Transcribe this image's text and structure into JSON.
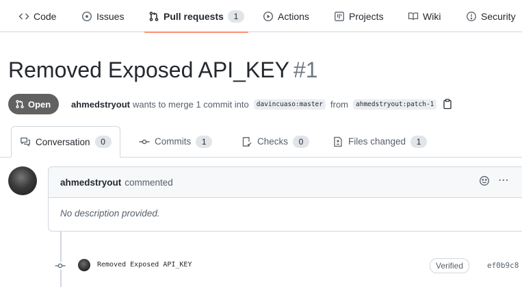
{
  "nav": {
    "items": [
      {
        "label": "Code",
        "icon": "code-icon"
      },
      {
        "label": "Issues",
        "icon": "issue-opened-icon"
      },
      {
        "label": "Pull requests",
        "icon": "git-pull-request-icon",
        "count": "1",
        "selected": true
      },
      {
        "label": "Actions",
        "icon": "play-icon"
      },
      {
        "label": "Projects",
        "icon": "table-icon"
      },
      {
        "label": "Wiki",
        "icon": "book-icon"
      },
      {
        "label": "Security",
        "icon": "shield-icon"
      }
    ]
  },
  "pr": {
    "title": "Removed Exposed API_KEY",
    "number": "#1",
    "state": "Open",
    "author": "ahmedstryout",
    "merge_text": "wants to merge 1 commit into",
    "base_branch": "davincuaso:master",
    "from_text": "from",
    "head_branch": "ahmedstryout:patch-1"
  },
  "tabs": [
    {
      "label": "Conversation",
      "count": "0",
      "icon": "comment-discussion-icon",
      "active": true
    },
    {
      "label": "Commits",
      "count": "1",
      "icon": "git-commit-icon"
    },
    {
      "label": "Checks",
      "count": "0",
      "icon": "checklist-icon"
    },
    {
      "label": "Files changed",
      "count": "1",
      "icon": "file-diff-icon"
    }
  ],
  "comment": {
    "author": "ahmedstryout",
    "action": "commented",
    "body": "No description provided."
  },
  "commit": {
    "message": "Removed Exposed API_KEY",
    "verified_label": "Verified",
    "sha": "ef0b9c8"
  },
  "colors": {
    "accent_underline": "#fd8c73",
    "state_badge": "#616161"
  }
}
